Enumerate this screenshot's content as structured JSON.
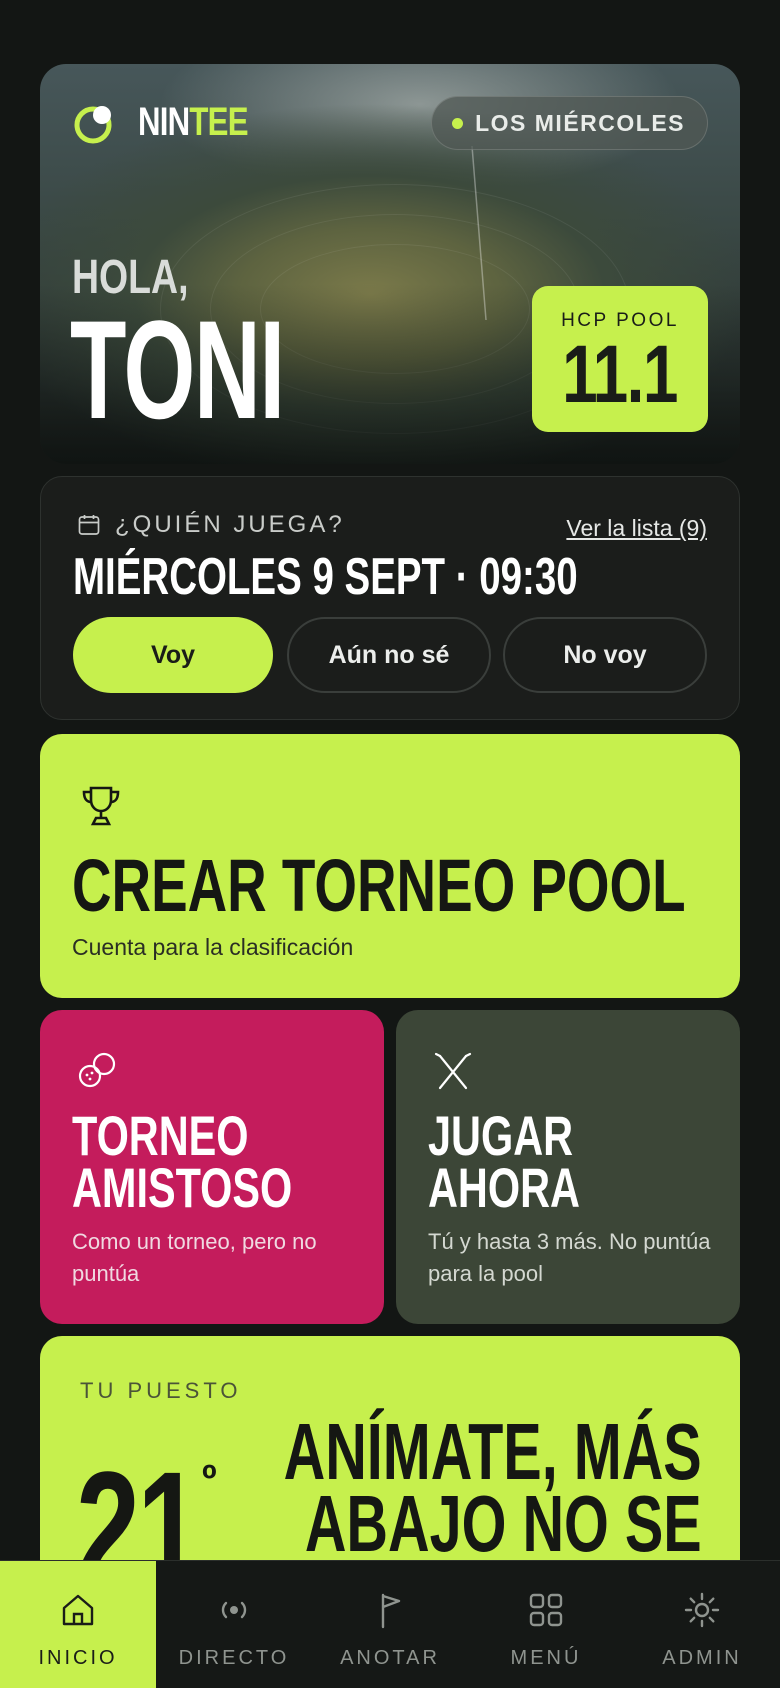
{
  "brand": {
    "name_part1": "NIN",
    "name_part2": "TEE"
  },
  "hero": {
    "day_pill": "LOS MIÉRCOLES",
    "greeting": "HOLA,",
    "user_name": "TONI",
    "hcp_label": "HCP POOL",
    "hcp_value": "11.1"
  },
  "who_plays": {
    "question": "¿QUIÉN JUEGA?",
    "list_link": "Ver la lista (9)",
    "date": "MIÉRCOLES 9 SEPT · 09:30",
    "buttons": {
      "yes": "Voy",
      "maybe": "Aún no sé",
      "no": "No voy"
    }
  },
  "create_pool": {
    "title": "CREAR TORNEO POOL",
    "subtitle": "Cuenta para la clasificación"
  },
  "friendly": {
    "title_line1": "TORNEO",
    "title_line2": "AMISTOSO",
    "subtitle": "Como un torneo, pero no puntúa"
  },
  "play_now": {
    "title_line1": "JUGAR",
    "title_line2": "AHORA",
    "subtitle": "Tú y hasta 3 más. No puntúa para la pool"
  },
  "rank": {
    "label": "TU PUESTO",
    "position": "21",
    "ordinal": "º",
    "message_line1": "ANÍMATE, MÁS",
    "message_line2": "ABAJO NO SE"
  },
  "nav": {
    "home": "INICIO",
    "live": "DIRECTO",
    "score": "ANOTAR",
    "menu": "MENÚ",
    "admin": "ADMIN"
  },
  "colors": {
    "accent": "#c6f04d",
    "friendly": "#c41c5c",
    "play_now": "#3c4637",
    "background": "#131614"
  }
}
